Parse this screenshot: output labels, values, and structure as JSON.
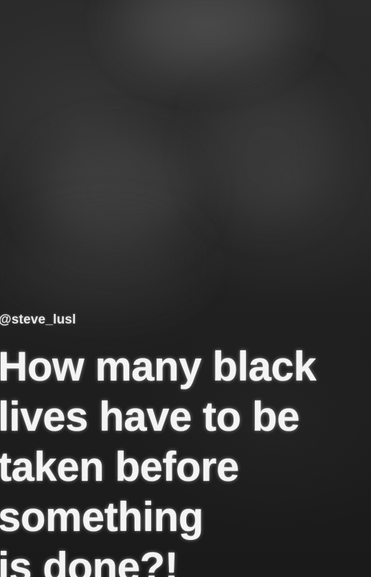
{
  "post": {
    "handle": "@steve_lusl",
    "headline_lines": [
      "How many black",
      "lives have to be",
      "taken before",
      "something",
      "is done?!"
    ]
  },
  "colors": {
    "background": "#1e1e1e",
    "text": "#f4f4f4"
  }
}
